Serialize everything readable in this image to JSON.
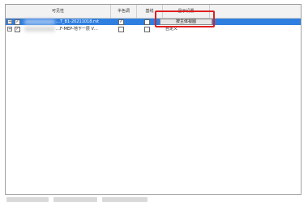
{
  "columns": {
    "visibility": "可见性",
    "halftone": "半色调",
    "underlay": "基线",
    "display": "显示设置"
  },
  "rows": [
    {
      "name": "…T_B1-20211018.rvt",
      "visible": true,
      "halftone": true,
      "underlay": false,
      "display": "按主体视图",
      "selected": true
    },
    {
      "name": "…F-MEP-地下一层 V…",
      "visible": true,
      "halftone": false,
      "underlay": false,
      "display": "自定义",
      "selected": false
    }
  ],
  "icons": {
    "expander": "+",
    "check": "✓"
  },
  "colors": {
    "selection": "#2f7fe0",
    "highlight": "#e02020"
  }
}
